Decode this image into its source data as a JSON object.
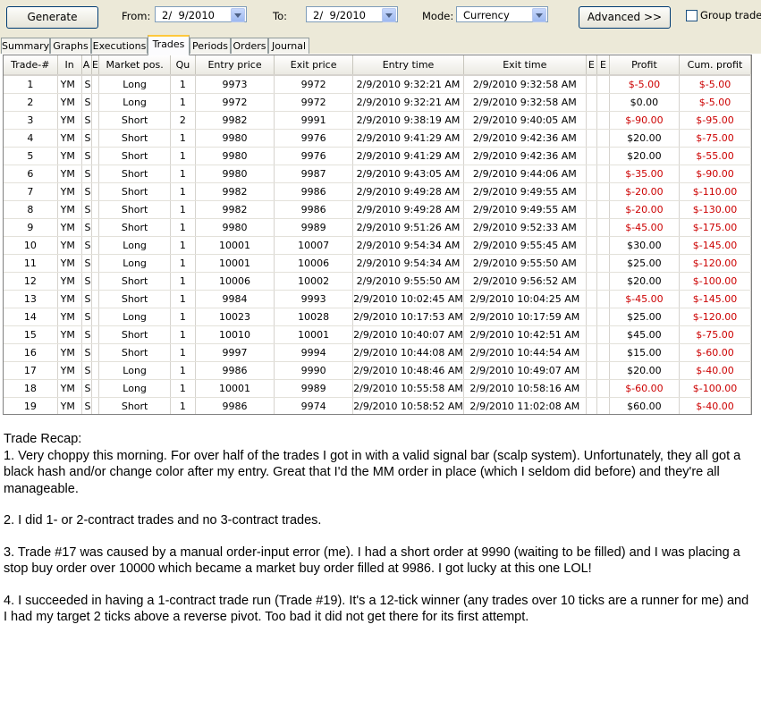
{
  "toolbar": {
    "generate_label": "Generate",
    "from_label": "From:",
    "from_value": "2/  9/2010",
    "to_label": "To:",
    "to_value": "2/  9/2010",
    "mode_label": "Mode:",
    "mode_value": "Currency",
    "advanced_label": "Advanced >>",
    "group_trades_label": "Group trades"
  },
  "tabs": [
    "Summary",
    "Graphs",
    "Executions",
    "Trades",
    "Periods",
    "Orders",
    "Journal"
  ],
  "active_tab": "Trades",
  "table": {
    "columns": [
      "Trade-#",
      "In",
      "A",
      "E",
      "Market pos.",
      "Qu",
      "Entry price",
      "Exit price",
      "Entry time",
      "Exit time",
      "E",
      "E",
      "Profit",
      "Cum. profit"
    ],
    "rows": [
      [
        "1",
        "YM",
        "S",
        "",
        "Long",
        "1",
        "9973",
        "9972",
        "2/9/2010 9:32:21 AM",
        "2/9/2010 9:32:58 AM",
        "",
        "",
        "$-5.00",
        "$-5.00"
      ],
      [
        "2",
        "YM",
        "S",
        "",
        "Long",
        "1",
        "9972",
        "9972",
        "2/9/2010 9:32:21 AM",
        "2/9/2010 9:32:58 AM",
        "",
        "",
        "$0.00",
        "$-5.00"
      ],
      [
        "3",
        "YM",
        "S",
        "",
        "Short",
        "2",
        "9982",
        "9991",
        "2/9/2010 9:38:19 AM",
        "2/9/2010 9:40:05 AM",
        "",
        "",
        "$-90.00",
        "$-95.00"
      ],
      [
        "4",
        "YM",
        "S",
        "",
        "Short",
        "1",
        "9980",
        "9976",
        "2/9/2010 9:41:29 AM",
        "2/9/2010 9:42:36 AM",
        "",
        "",
        "$20.00",
        "$-75.00"
      ],
      [
        "5",
        "YM",
        "S",
        "",
        "Short",
        "1",
        "9980",
        "9976",
        "2/9/2010 9:41:29 AM",
        "2/9/2010 9:42:36 AM",
        "",
        "",
        "$20.00",
        "$-55.00"
      ],
      [
        "6",
        "YM",
        "S",
        "",
        "Short",
        "1",
        "9980",
        "9987",
        "2/9/2010 9:43:05 AM",
        "2/9/2010 9:44:06 AM",
        "",
        "",
        "$-35.00",
        "$-90.00"
      ],
      [
        "7",
        "YM",
        "S",
        "",
        "Short",
        "1",
        "9982",
        "9986",
        "2/9/2010 9:49:28 AM",
        "2/9/2010 9:49:55 AM",
        "",
        "",
        "$-20.00",
        "$-110.00"
      ],
      [
        "8",
        "YM",
        "S",
        "",
        "Short",
        "1",
        "9982",
        "9986",
        "2/9/2010 9:49:28 AM",
        "2/9/2010 9:49:55 AM",
        "",
        "",
        "$-20.00",
        "$-130.00"
      ],
      [
        "9",
        "YM",
        "S",
        "",
        "Short",
        "1",
        "9980",
        "9989",
        "2/9/2010 9:51:26 AM",
        "2/9/2010 9:52:33 AM",
        "",
        "",
        "$-45.00",
        "$-175.00"
      ],
      [
        "10",
        "YM",
        "S",
        "",
        "Long",
        "1",
        "10001",
        "10007",
        "2/9/2010 9:54:34 AM",
        "2/9/2010 9:55:45 AM",
        "",
        "",
        "$30.00",
        "$-145.00"
      ],
      [
        "11",
        "YM",
        "S",
        "",
        "Long",
        "1",
        "10001",
        "10006",
        "2/9/2010 9:54:34 AM",
        "2/9/2010 9:55:50 AM",
        "",
        "",
        "$25.00",
        "$-120.00"
      ],
      [
        "12",
        "YM",
        "S",
        "",
        "Short",
        "1",
        "10006",
        "10002",
        "2/9/2010 9:55:50 AM",
        "2/9/2010 9:56:52 AM",
        "",
        "",
        "$20.00",
        "$-100.00"
      ],
      [
        "13",
        "YM",
        "S",
        "",
        "Short",
        "1",
        "9984",
        "9993",
        "2/9/2010 10:02:45 AM",
        "2/9/2010 10:04:25 AM",
        "",
        "",
        "$-45.00",
        "$-145.00"
      ],
      [
        "14",
        "YM",
        "S",
        "",
        "Long",
        "1",
        "10023",
        "10028",
        "2/9/2010 10:17:53 AM",
        "2/9/2010 10:17:59 AM",
        "",
        "",
        "$25.00",
        "$-120.00"
      ],
      [
        "15",
        "YM",
        "S",
        "",
        "Short",
        "1",
        "10010",
        "10001",
        "2/9/2010 10:40:07 AM",
        "2/9/2010 10:42:51 AM",
        "",
        "",
        "$45.00",
        "$-75.00"
      ],
      [
        "16",
        "YM",
        "S",
        "",
        "Short",
        "1",
        "9997",
        "9994",
        "2/9/2010 10:44:08 AM",
        "2/9/2010 10:44:54 AM",
        "",
        "",
        "$15.00",
        "$-60.00"
      ],
      [
        "17",
        "YM",
        "S",
        "",
        "Long",
        "1",
        "9986",
        "9990",
        "2/9/2010 10:48:46 AM",
        "2/9/2010 10:49:07 AM",
        "",
        "",
        "$20.00",
        "$-40.00"
      ],
      [
        "18",
        "YM",
        "S",
        "",
        "Long",
        "1",
        "10001",
        "9989",
        "2/9/2010 10:55:58 AM",
        "2/9/2010 10:58:16 AM",
        "",
        "",
        "$-60.00",
        "$-100.00"
      ],
      [
        "19",
        "YM",
        "S",
        "",
        "Short",
        "1",
        "9986",
        "9974",
        "2/9/2010 10:58:52 AM",
        "2/9/2010 11:02:08 AM",
        "",
        "",
        "$60.00",
        "$-40.00"
      ]
    ]
  },
  "colors": {
    "negative": "#cc0000",
    "tab_highlight": "#ffc83c",
    "window_bg": "#ece9d8"
  },
  "notes": {
    "heading": "Trade Recap:",
    "paragraphs": [
      "1.  Very choppy this morning.  For over half of the trades I got in with a valid signal bar (scalp system).  Unfortunately, they all got a black hash and/or change color after my entry.  Great that I'd the MM order in place (which I seldom did before) and they're all manageable.",
      "2.  I did 1- or 2-contract trades and no 3-contract trades.",
      "3.  Trade #17 was caused by a manual order-input error (me).  I had a short order at 9990 (waiting to be filled) and I was placing a stop buy order over 10000 which became a market buy order filled at 9986.  I got lucky at this one LOL!",
      "4.  I succeeded in having a 1-contract trade run (Trade #19).  It's a 12-tick winner (any trades over 10 ticks are a runner for me) and I had my target 2 ticks above a reverse pivot.  Too bad it did not get there for its first attempt."
    ]
  }
}
